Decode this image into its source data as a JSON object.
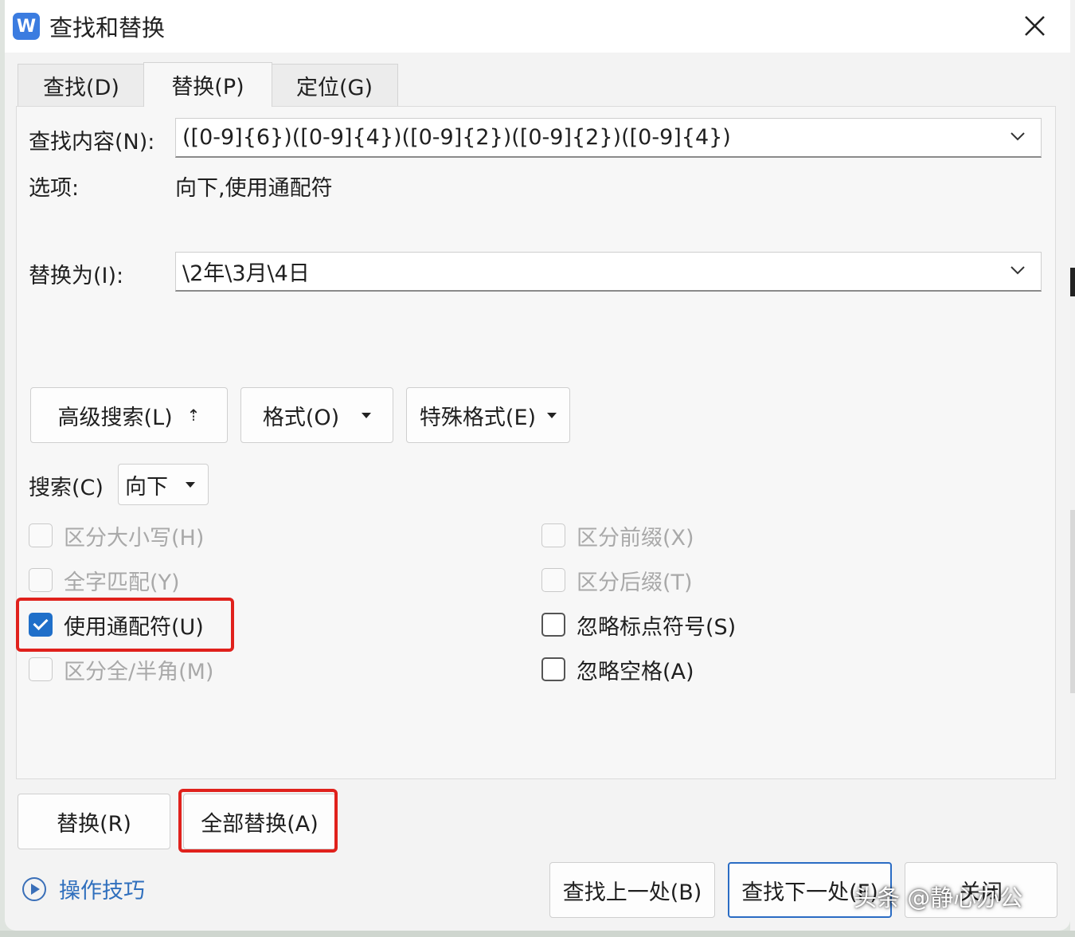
{
  "window": {
    "title": "查找和替换",
    "app_icon_letter": "W"
  },
  "tabs": [
    {
      "label": "查找(D)"
    },
    {
      "label": "替换(P)"
    },
    {
      "label": "定位(G)"
    }
  ],
  "find": {
    "label": "查找内容(N):",
    "value": "([0-9]{6})([0-9]{4})([0-9]{2})([0-9]{2})([0-9]{4})"
  },
  "options": {
    "label": "选项:",
    "value": "向下,使用通配符"
  },
  "replace": {
    "label": "替换为(I):",
    "value": "\\2年\\3月\\4日"
  },
  "action_buttons": {
    "advanced": "高级搜索(L)",
    "advanced_glyph": "⇡",
    "format": "格式(O)",
    "special": "特殊格式(E)"
  },
  "search": {
    "label": "搜索(C)",
    "value": "向下"
  },
  "checkboxes_left": [
    {
      "label": "区分大小写(H)",
      "checked": false,
      "enabled": false
    },
    {
      "label": "全字匹配(Y)",
      "checked": false,
      "enabled": false
    },
    {
      "label": "使用通配符(U)",
      "checked": true,
      "enabled": true
    },
    {
      "label": "区分全/半角(M)",
      "checked": false,
      "enabled": false
    }
  ],
  "checkboxes_right": [
    {
      "label": "区分前缀(X)",
      "checked": false,
      "enabled": false
    },
    {
      "label": "区分后缀(T)",
      "checked": false,
      "enabled": false
    },
    {
      "label": "忽略标点符号(S)",
      "checked": false,
      "enabled": true
    },
    {
      "label": "忽略空格(A)",
      "checked": false,
      "enabled": true
    }
  ],
  "bottom_buttons": {
    "replace": "替换(R)",
    "replace_all": "全部替换(A)",
    "find_prev": "查找上一处(B)",
    "find_next": "查找下一处(F)",
    "close": "关闭"
  },
  "tips": {
    "label": "操作技巧"
  },
  "watermark": "头条 @静心办公",
  "colors": {
    "accent": "#1f6fc9",
    "highlight": "#e0211c",
    "link": "#2f6fbd"
  }
}
